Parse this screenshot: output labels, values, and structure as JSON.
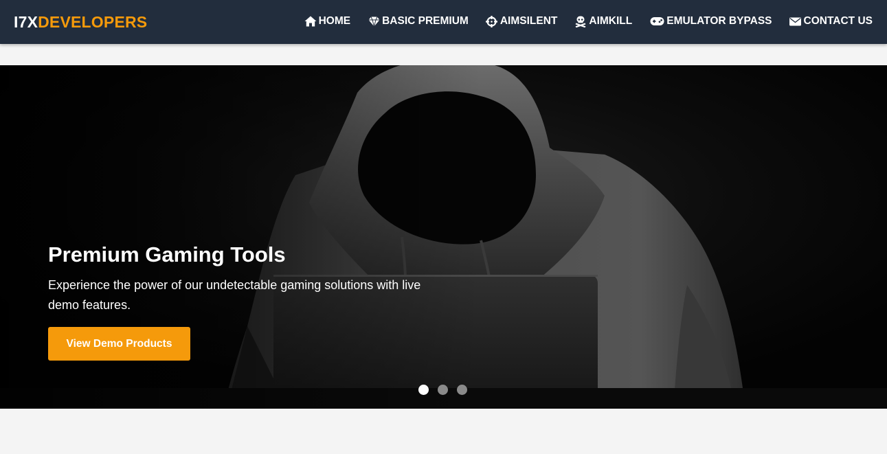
{
  "brand": {
    "part1": "I7X",
    "part2": "DEVELOPERS"
  },
  "nav": [
    {
      "label": "HOME",
      "icon": "home-icon"
    },
    {
      "label": "BASIC PREMIUM",
      "icon": "gem-icon"
    },
    {
      "label": "AIMSILENT",
      "icon": "crosshairs-icon"
    },
    {
      "label": "AIMKILL",
      "icon": "skull-crossbones-icon"
    },
    {
      "label": "EMULATOR BYPASS",
      "icon": "gamepad-icon"
    },
    {
      "label": "CONTACT US",
      "icon": "envelope-icon"
    }
  ],
  "hero": {
    "title": "Premium Gaming Tools",
    "text": "Experience the power of our undetectable gaming solutions with live demo features.",
    "button_label": "View Demo Products",
    "image": "hooded-person-at-laptop",
    "slide_count": 3,
    "active_slide": 1
  },
  "colors": {
    "nav_background": "#222d3d",
    "accent": "#f59a0b",
    "page_background": "#f4f4f4"
  }
}
